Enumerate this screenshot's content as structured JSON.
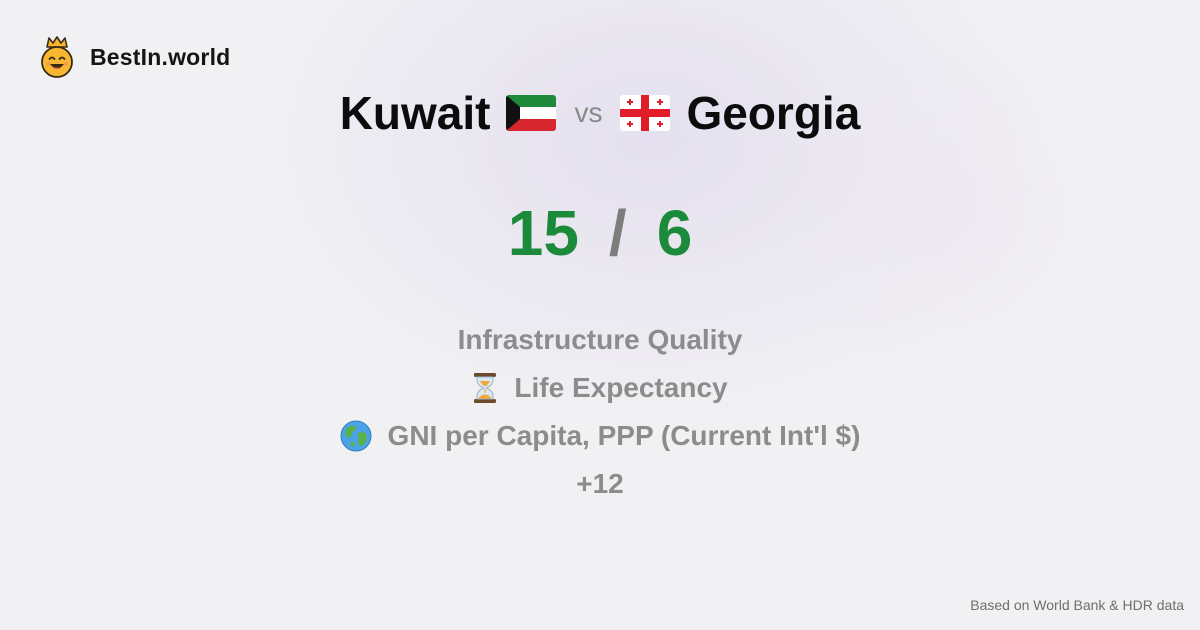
{
  "brand": {
    "name": "BestIn.world",
    "logo_icon": "crowned-smiley-icon"
  },
  "comparison": {
    "left": {
      "name": "Kuwait",
      "flag_icon": "kuwait-flag-icon",
      "score": "15"
    },
    "separator": "vs",
    "right": {
      "name": "Georgia",
      "flag_icon": "georgia-flag-icon",
      "score": "6"
    },
    "score_separator": "/"
  },
  "categories": [
    {
      "label": "Infrastructure Quality",
      "icon": ""
    },
    {
      "label": "Life Expectancy",
      "icon": "hourglass-icon"
    },
    {
      "label": "GNI per Capita, PPP (Current Int'l $)",
      "icon": "globe-icon"
    }
  ],
  "more_count": "+12",
  "footer": {
    "source": "Based on World Bank & HDR data"
  },
  "colors": {
    "score": "#1b8a3a",
    "muted": "#8c8c8c",
    "background": "#f1f1f3"
  }
}
